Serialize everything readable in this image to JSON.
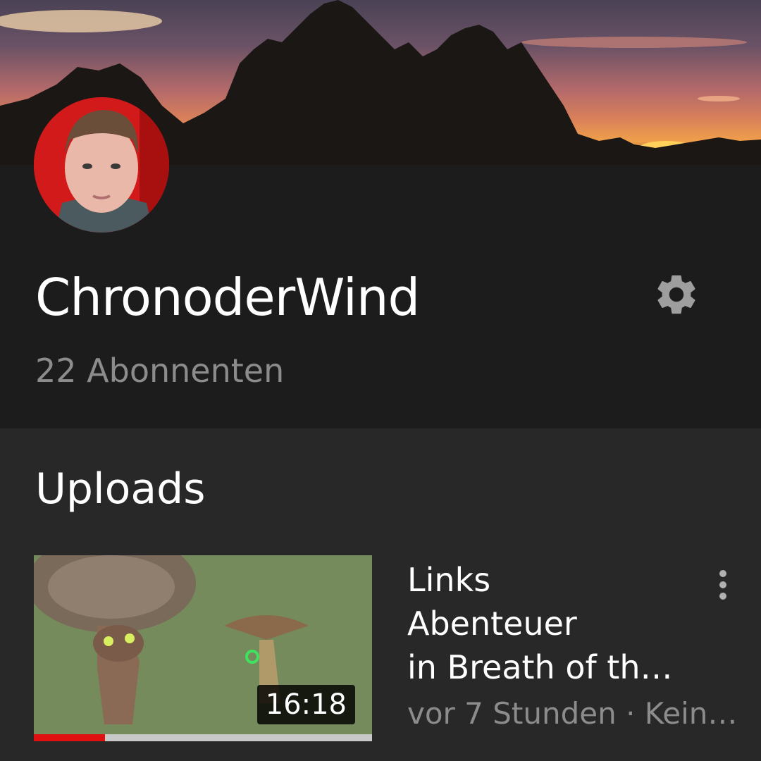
{
  "channel": {
    "name": "ChronoderWind",
    "subscribers": "22 Abonnenten"
  },
  "sections": {
    "uploads_title": "Uploads"
  },
  "videos": [
    {
      "title_lines": [
        "Links",
        "Abenteuer",
        "in Breath of th…"
      ],
      "meta": "vor 7 Stunden · Kein…",
      "duration": "16:18",
      "watch_progress_fraction": 0.21
    }
  ],
  "icons": {
    "settings": "gear-icon",
    "more": "more-vert-icon"
  },
  "colors": {
    "background": "#282828",
    "header_background": "#1c1c1c",
    "progress": "#e01010",
    "secondary_text": "#8c8c8c"
  }
}
